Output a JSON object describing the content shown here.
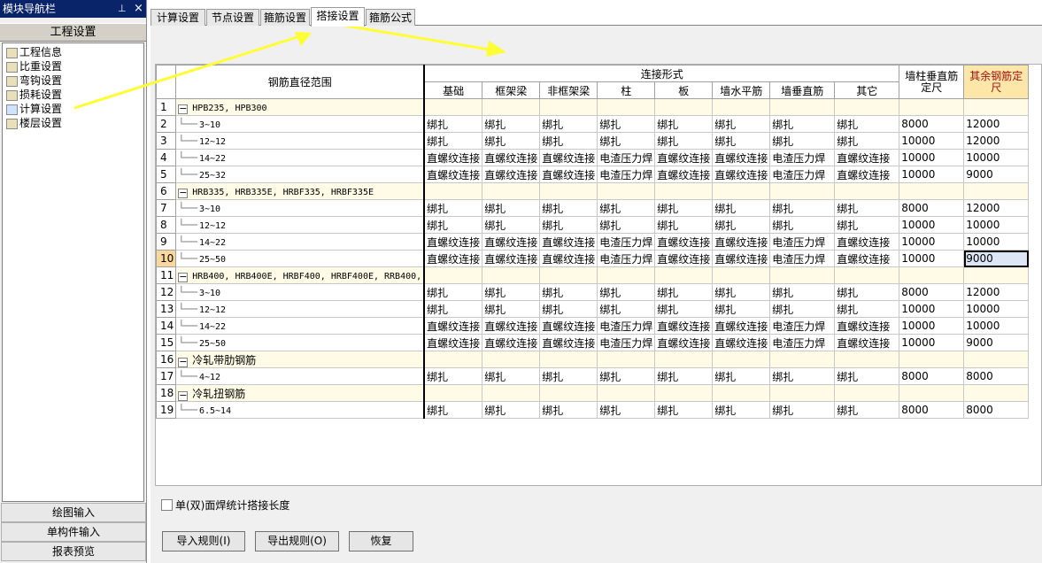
{
  "nav": {
    "title": "模块导航栏",
    "pin": "⊥",
    "close": "×",
    "header": "工程设置",
    "items": [
      {
        "label": "工程信息",
        "icon": "folder-icon"
      },
      {
        "label": "比重设置",
        "icon": "weight-icon"
      },
      {
        "label": "弯钩设置",
        "icon": "hook-icon"
      },
      {
        "label": "损耗设置",
        "icon": "loss-icon"
      },
      {
        "label": "计算设置",
        "icon": "calc-icon"
      },
      {
        "label": "楼层设置",
        "icon": "floor-icon"
      }
    ],
    "bottom": [
      "绘图输入",
      "单构件输入",
      "报表预览"
    ]
  },
  "tabs": [
    "计算设置",
    "节点设置",
    "箍筋设置",
    "搭接设置",
    "箍筋公式"
  ],
  "active_tab": "搭接设置",
  "grid": {
    "h_range": "钢筋直径范围",
    "h_conn": "连接形式",
    "h_cols": [
      "基础",
      "框架梁",
      "非框架梁",
      "柱",
      "板",
      "墙水平筋",
      "墙垂直筋",
      "其它"
    ],
    "h_wall": "墙柱垂直筋定尺",
    "h_other": "其余钢筋定尺",
    "rows": [
      {
        "n": "1",
        "label": "HPB235, HPB300",
        "group": true
      },
      {
        "n": "2",
        "label": "3~10",
        "cells": [
          "绑扎",
          "绑扎",
          "绑扎",
          "绑扎",
          "绑扎",
          "绑扎",
          "绑扎",
          "绑扎",
          "8000",
          "12000"
        ]
      },
      {
        "n": "3",
        "label": "12~12",
        "cells": [
          "绑扎",
          "绑扎",
          "绑扎",
          "绑扎",
          "绑扎",
          "绑扎",
          "绑扎",
          "绑扎",
          "10000",
          "12000"
        ]
      },
      {
        "n": "4",
        "label": "14~22",
        "cells": [
          "直螺纹连接",
          "直螺纹连接",
          "直螺纹连接",
          "电渣压力焊",
          "直螺纹连接",
          "直螺纹连接",
          "电渣压力焊",
          "直螺纹连接",
          "10000",
          "10000"
        ]
      },
      {
        "n": "5",
        "label": "25~32",
        "cells": [
          "直螺纹连接",
          "直螺纹连接",
          "直螺纹连接",
          "电渣压力焊",
          "直螺纹连接",
          "直螺纹连接",
          "电渣压力焊",
          "直螺纹连接",
          "10000",
          "9000"
        ]
      },
      {
        "n": "6",
        "label": "HRB335, HRB335E, HRBF335, HRBF335E",
        "group": true
      },
      {
        "n": "7",
        "label": "3~10",
        "cells": [
          "绑扎",
          "绑扎",
          "绑扎",
          "绑扎",
          "绑扎",
          "绑扎",
          "绑扎",
          "绑扎",
          "8000",
          "12000"
        ]
      },
      {
        "n": "8",
        "label": "12~12",
        "cells": [
          "绑扎",
          "绑扎",
          "绑扎",
          "绑扎",
          "绑扎",
          "绑扎",
          "绑扎",
          "绑扎",
          "10000",
          "10000"
        ]
      },
      {
        "n": "9",
        "label": "14~22",
        "cells": [
          "直螺纹连接",
          "直螺纹连接",
          "直螺纹连接",
          "电渣压力焊",
          "直螺纹连接",
          "直螺纹连接",
          "电渣压力焊",
          "直螺纹连接",
          "10000",
          "10000"
        ]
      },
      {
        "n": "10",
        "label": "25~50",
        "cells": [
          "直螺纹连接",
          "直螺纹连接",
          "直螺纹连接",
          "电渣压力焊",
          "直螺纹连接",
          "直螺纹连接",
          "电渣压力焊",
          "直螺纹连接",
          "10000",
          "9000"
        ],
        "selected": true
      },
      {
        "n": "11",
        "label": "HRB400, HRB400E, HRBF400, HRBF400E, RRB400,",
        "group": true
      },
      {
        "n": "12",
        "label": "3~10",
        "cells": [
          "绑扎",
          "绑扎",
          "绑扎",
          "绑扎",
          "绑扎",
          "绑扎",
          "绑扎",
          "绑扎",
          "8000",
          "12000"
        ]
      },
      {
        "n": "13",
        "label": "12~12",
        "cells": [
          "绑扎",
          "绑扎",
          "绑扎",
          "绑扎",
          "绑扎",
          "绑扎",
          "绑扎",
          "绑扎",
          "10000",
          "10000"
        ]
      },
      {
        "n": "14",
        "label": "14~22",
        "cells": [
          "直螺纹连接",
          "直螺纹连接",
          "直螺纹连接",
          "电渣压力焊",
          "直螺纹连接",
          "直螺纹连接",
          "电渣压力焊",
          "直螺纹连接",
          "10000",
          "10000"
        ]
      },
      {
        "n": "15",
        "label": "25~50",
        "cells": [
          "直螺纹连接",
          "直螺纹连接",
          "直螺纹连接",
          "电渣压力焊",
          "直螺纹连接",
          "直螺纹连接",
          "电渣压力焊",
          "直螺纹连接",
          "10000",
          "9000"
        ]
      },
      {
        "n": "16",
        "label": "冷轧带肋钢筋",
        "group": true
      },
      {
        "n": "17",
        "label": "4~12",
        "cells": [
          "绑扎",
          "绑扎",
          "绑扎",
          "绑扎",
          "绑扎",
          "绑扎",
          "绑扎",
          "绑扎",
          "8000",
          "8000"
        ]
      },
      {
        "n": "18",
        "label": "冷轧扭钢筋",
        "group": true
      },
      {
        "n": "19",
        "label": "6.5~14",
        "cells": [
          "绑扎",
          "绑扎",
          "绑扎",
          "绑扎",
          "绑扎",
          "绑扎",
          "绑扎",
          "绑扎",
          "8000",
          "8000"
        ]
      }
    ]
  },
  "checkbox_label": "单(双)面焊统计搭接长度",
  "buttons": [
    "导入规则(I)",
    "导出规则(O)",
    "恢复"
  ],
  "colors": {
    "arrow": "#ffff33",
    "selected_header": "#fce6a8",
    "nav_header": "#0a246a"
  }
}
